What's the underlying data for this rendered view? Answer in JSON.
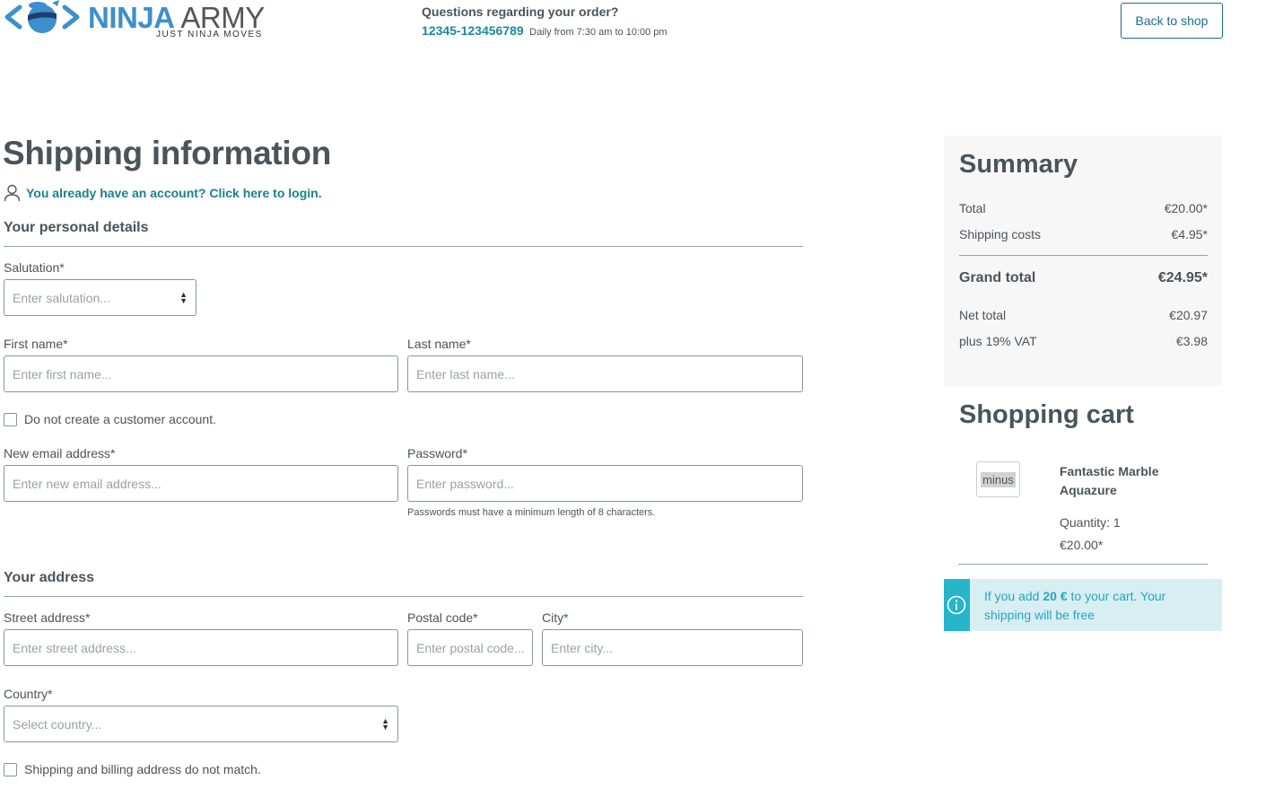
{
  "header": {
    "brand_primary": "NINJA",
    "brand_secondary": "ARMY",
    "tagline": "JUST NINJA MOVES",
    "contact_question": "Questions regarding your order?",
    "contact_phone": "12345-123456789",
    "contact_hours": "Daily from 7:30 am to 10:00 pm",
    "back_button": "Back to shop"
  },
  "page": {
    "title": "Shipping information",
    "login_link": "You already have an account? Click here to login."
  },
  "personal": {
    "section_title": "Your personal details",
    "salutation_label": "Salutation*",
    "salutation_placeholder": "Enter salutation...",
    "first_name_label": "First name*",
    "first_name_placeholder": "Enter first name...",
    "last_name_label": "Last name*",
    "last_name_placeholder": "Enter last name...",
    "no_account_label": "Do not create a customer account.",
    "email_label": "New email address*",
    "email_placeholder": "Enter new email address...",
    "password_label": "Password*",
    "password_placeholder": "Enter password...",
    "password_hint": "Passwords must have a minimum length of 8 characters."
  },
  "address": {
    "section_title": "Your address",
    "street_label": "Street address*",
    "street_placeholder": "Enter street address...",
    "postal_label": "Postal code*",
    "postal_placeholder": "Enter postal code...",
    "city_label": "City*",
    "city_placeholder": "Enter city...",
    "country_label": "Country*",
    "country_placeholder": "Select country...",
    "different_billing_label": "Shipping and billing address do not match."
  },
  "summary": {
    "title": "Summary",
    "total_label": "Total",
    "total_value": "€20.00*",
    "shipping_label": "Shipping costs",
    "shipping_value": "€4.95*",
    "grand_label": "Grand total",
    "grand_value": "€24.95*",
    "net_label": "Net total",
    "net_value": "€20.97",
    "vat_label": "plus 19% VAT",
    "vat_value": "€3.98"
  },
  "cart": {
    "title": "Shopping cart",
    "thumb_text": "minus",
    "item_name": "Fantastic Marble Aquazure",
    "item_quantity": "Quantity: 1",
    "item_price": "€20.00*",
    "info_prefix": "If you add ",
    "info_amount": "20 €",
    "info_suffix": " to your cart. Your shipping will be free"
  },
  "colors": {
    "text": "#4a545b",
    "link": "#1a7f8e",
    "brand_blue": "#3d8fce",
    "info_bg": "#d7eef2",
    "info_accent": "#26b5c9"
  },
  "icons": {
    "logo": "ninja-logo-icon",
    "user": "user-icon",
    "select": "select-arrows-icon",
    "info": "info-icon"
  }
}
